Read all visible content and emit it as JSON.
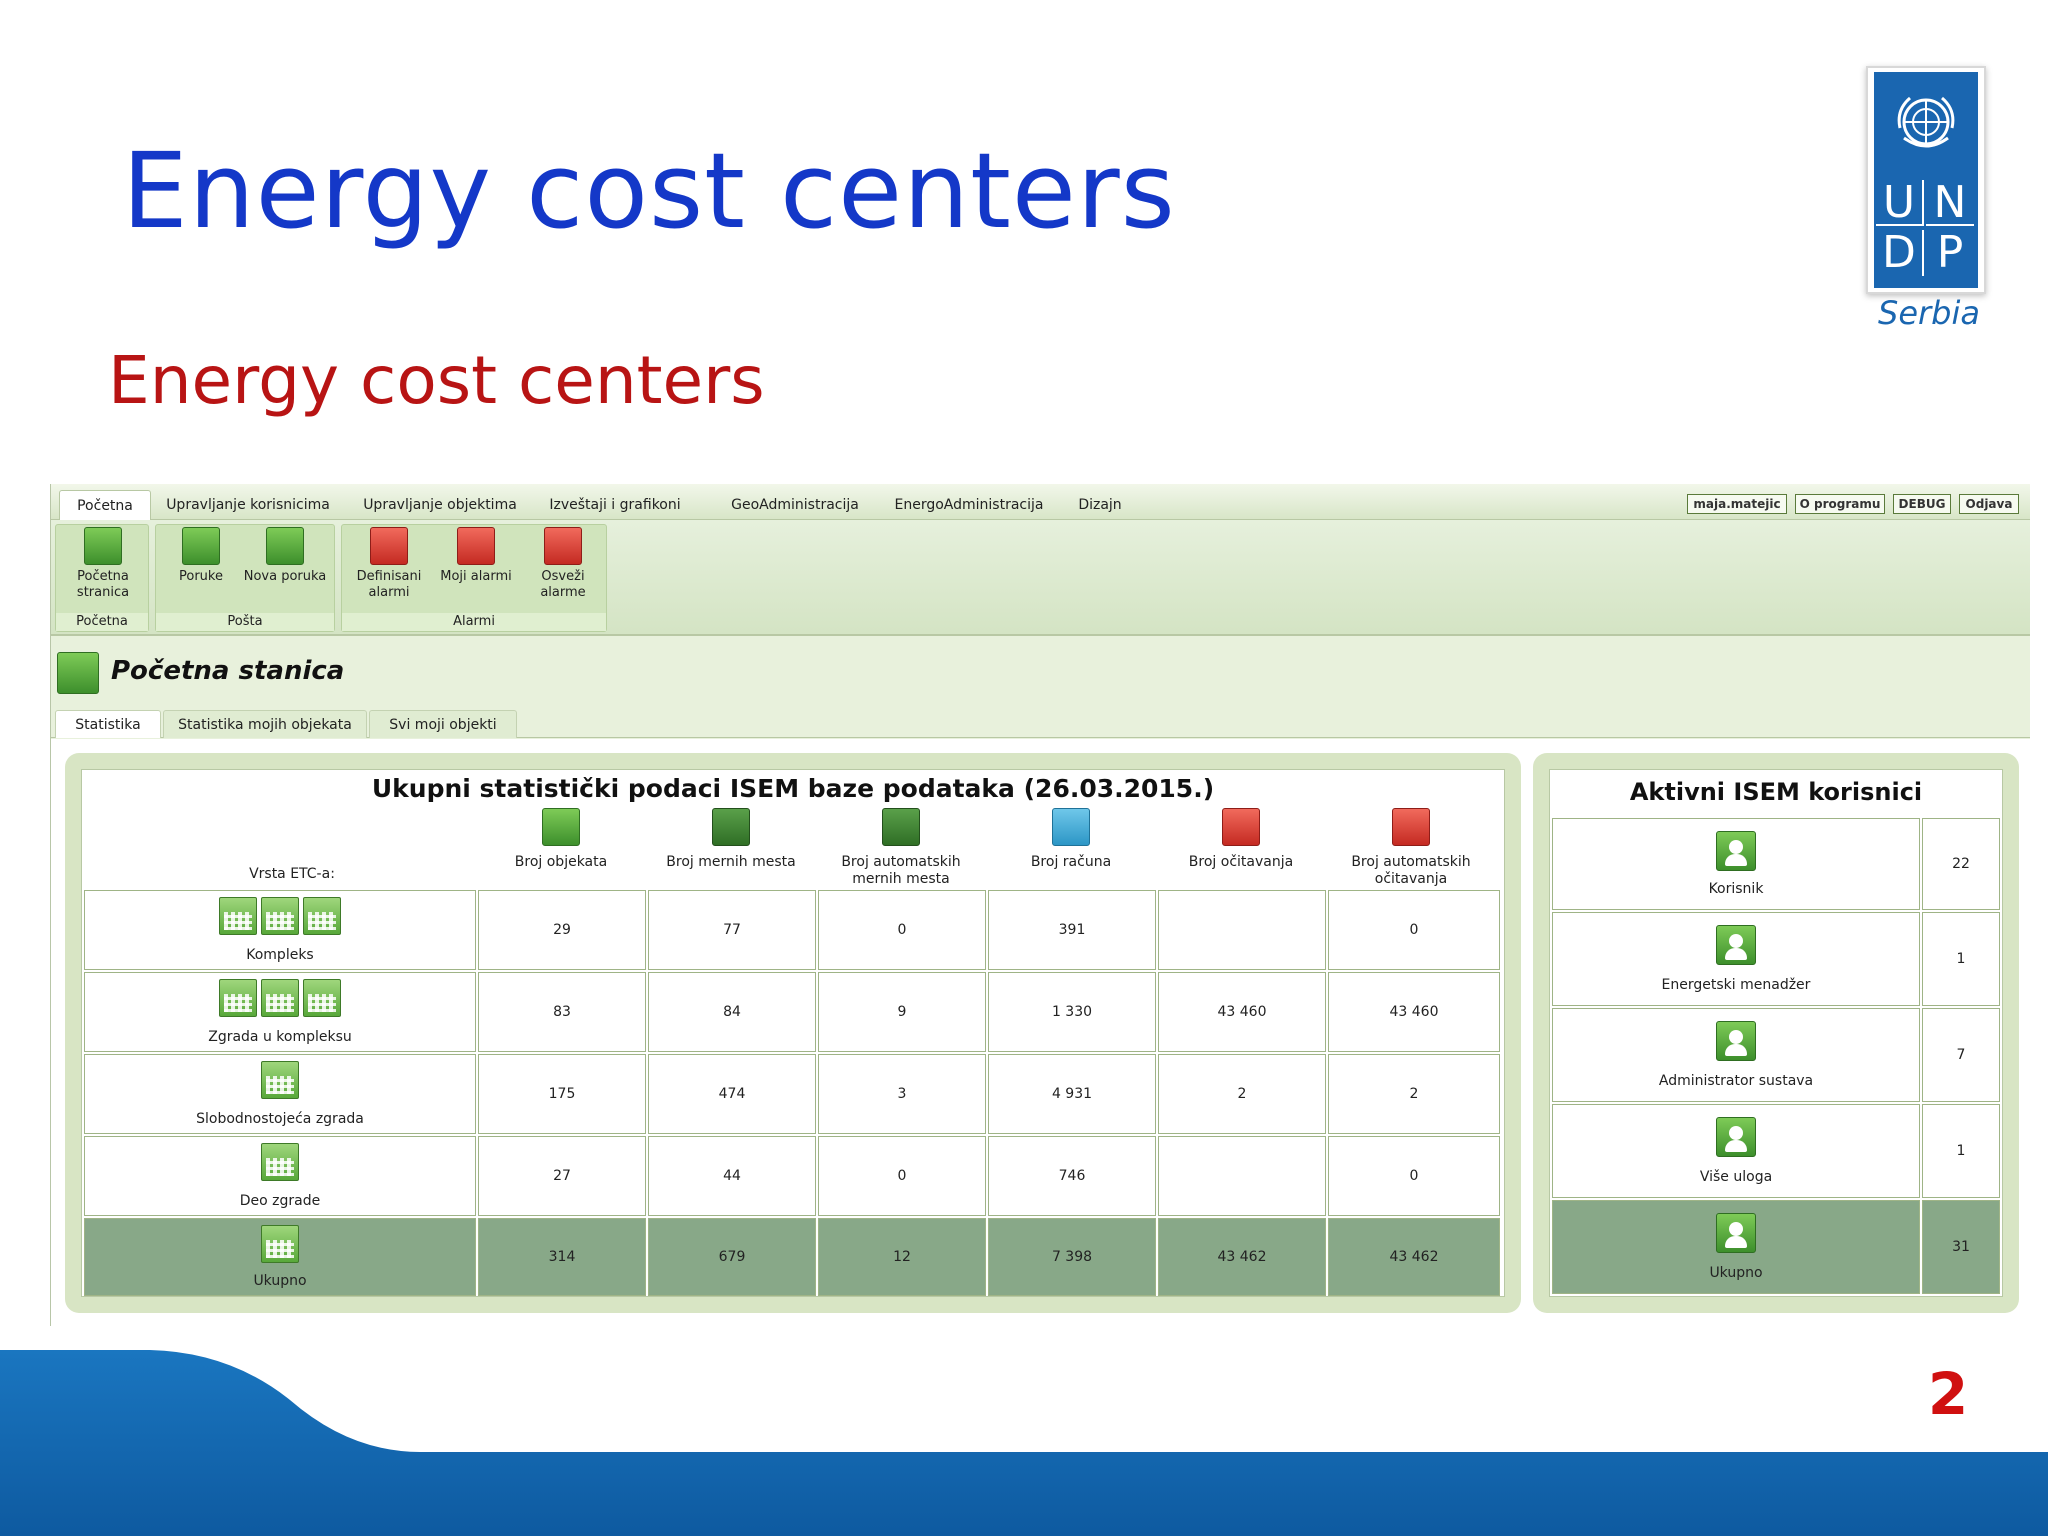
{
  "slide": {
    "title": "Energy cost centers",
    "subtitle": "Energy cost centers",
    "page_number": "2",
    "title_color": "#1438c8",
    "subtitle_color": "#b81414"
  },
  "logo": {
    "letters": [
      "U",
      "N",
      "D",
      "P"
    ],
    "country": "Serbia",
    "color": "#1a66b0"
  },
  "app": {
    "menu": [
      "Početna",
      "Upravljanje korisnicima",
      "Upravljanje objektima",
      "Izveštaji i grafikoni",
      "GeoAdministracija",
      "EnergoAdministracija",
      "Dizajn"
    ],
    "top_buttons": [
      "maja.matejic",
      "O programu",
      "DEBUG",
      "Odjava"
    ],
    "ribbon": {
      "groups": [
        {
          "label": "Početna",
          "buttons": [
            {
              "line1": "Početna",
              "line2": "stranica",
              "icon": "chart-icon"
            }
          ]
        },
        {
          "label": "Pošta",
          "buttons": [
            {
              "line1": "Poruke",
              "line2": "",
              "icon": "inbox-icon"
            },
            {
              "line1": "Nova poruka",
              "line2": "",
              "icon": "envelope-icon"
            }
          ]
        },
        {
          "label": "Alarmi",
          "buttons": [
            {
              "line1": "Definisani",
              "line2": "alarmi",
              "icon": "alarm-clock-icon"
            },
            {
              "line1": "Moji alarmi",
              "line2": "",
              "icon": "alarm-clock-icon"
            },
            {
              "line1": "Osveži",
              "line2": "alarme",
              "icon": "alarm-refresh-icon"
            }
          ]
        }
      ]
    },
    "page_title": "Početna stanica",
    "subtabs": [
      "Statistika",
      "Statistika mojih objekata",
      "Svi moji objekti"
    ]
  },
  "stats": {
    "title": "Ukupni statistički podaci ISEM baze podataka (26.03.2015.)",
    "row_header": "Vrsta ETC-a:",
    "columns": [
      {
        "label1": "Broj objekata",
        "label2": "",
        "icon": "building-grid-icon"
      },
      {
        "label1": "Broj mernih mesta",
        "label2": "",
        "icon": "meter-icon"
      },
      {
        "label1": "Broj automatskih",
        "label2": "mernih mesta",
        "icon": "meter-icon"
      },
      {
        "label1": "Broj računa",
        "label2": "",
        "icon": "invoice-icon"
      },
      {
        "label1": "Broj očitavanja",
        "label2": "",
        "icon": "reading-chart-icon"
      },
      {
        "label1": "Broj automatskih",
        "label2": "očitavanja",
        "icon": "reading-chart-icon"
      }
    ],
    "rows": [
      {
        "label": "Kompleks",
        "values": [
          "29",
          "77",
          "0",
          "391",
          "",
          "0"
        ],
        "icons": 3
      },
      {
        "label": "Zgrada u kompleksu",
        "values": [
          "83",
          "84",
          "9",
          "1 330",
          "43 460",
          "43 460"
        ],
        "icons": 3
      },
      {
        "label": "Slobodnostojeća zgrada",
        "values": [
          "175",
          "474",
          "3",
          "4 931",
          "2",
          "2"
        ],
        "icons": 1
      },
      {
        "label": "Deo zgrade",
        "values": [
          "27",
          "44",
          "0",
          "746",
          "",
          "0"
        ],
        "icons": 1
      }
    ],
    "total": {
      "label": "Ukupno",
      "values": [
        "314",
        "679",
        "12",
        "7 398",
        "43 462",
        "43 462"
      ]
    }
  },
  "users": {
    "title": "Aktivni ISEM korisnici",
    "rows": [
      {
        "label": "Korisnik",
        "count": "22"
      },
      {
        "label": "Energetski menadžer",
        "count": "1"
      },
      {
        "label": "Administrator sustava",
        "count": "7"
      },
      {
        "label": "Više uloga",
        "count": "1"
      }
    ],
    "total": {
      "label": "Ukupno",
      "count": "31"
    }
  }
}
